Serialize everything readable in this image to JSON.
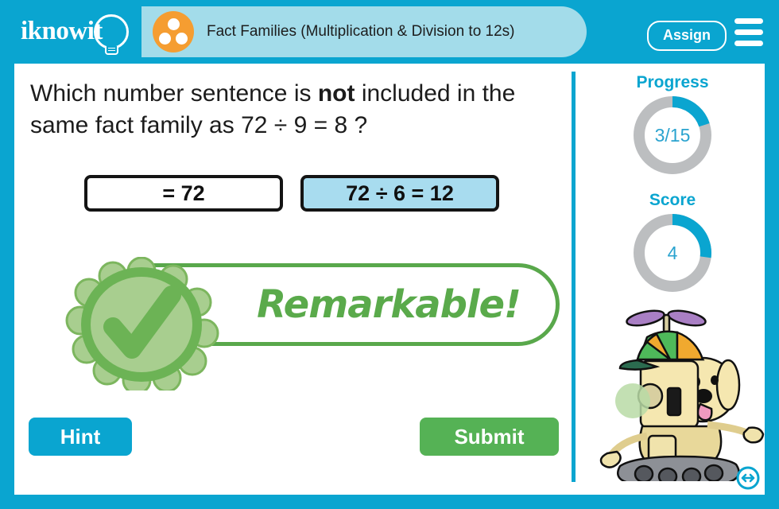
{
  "header": {
    "logo_text": "iknowit",
    "logo_icon": "lightbulb-icon",
    "subject_icon": "three-dots-circle-icon",
    "lesson_title": "Fact Families (Multiplication & Division to 12s)",
    "assign_label": "Assign",
    "menu_icon": "hamburger-menu-icon",
    "bar_color": "#0aa5d0",
    "pill_color": "#a3dcea",
    "badge_color": "#f59d31"
  },
  "question": {
    "prefix": "Which number sentence is ",
    "emphasis": "not",
    "suffix": " included in the same fact family as 72 ÷ 9 = 8 ?"
  },
  "choices": [
    {
      "label": "= 72",
      "selected": false,
      "occluded": true
    },
    {
      "label": "72 ÷ 6 = 12",
      "selected": true,
      "occluded": false
    }
  ],
  "feedback": {
    "text": "Remarkable!",
    "seal_icon": "green-checkmark-seal-icon",
    "accent": "#5aaa4b"
  },
  "sidebar": {
    "progress": {
      "label": "Progress",
      "value": "3/15",
      "percent": 20,
      "track_color": "#bcbec0",
      "fill_color": "#0aa5d0"
    },
    "score": {
      "label": "Score",
      "value": "4",
      "percent": 27,
      "track_color": "#bcbec0",
      "fill_color": "#0aa5d0"
    },
    "mascot_icon": "robot-with-dog-icon",
    "resize_icon": "horizontal-resize-circle-icon"
  },
  "footer": {
    "hint_label": "Hint",
    "hint_color": "#0aa5d0",
    "submit_label": "Submit",
    "submit_color": "#55b255"
  }
}
